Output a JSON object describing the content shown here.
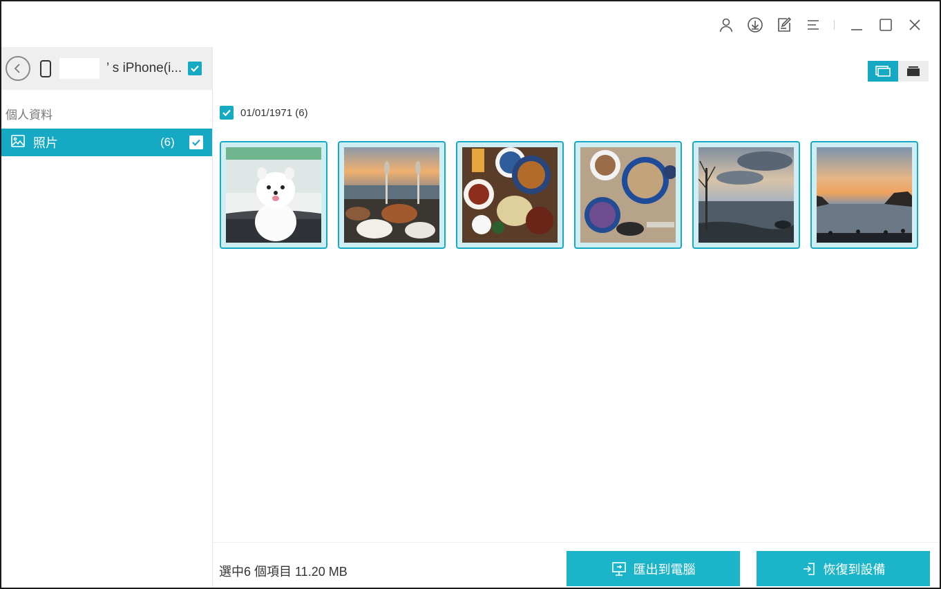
{
  "titlebar": {
    "icons": [
      "user-icon",
      "download-icon",
      "edit-icon",
      "menu-icon",
      "minimize-icon",
      "maximize-icon",
      "close-icon"
    ]
  },
  "device": {
    "name": "’ s iPhone(i..."
  },
  "sidebar": {
    "section_label": "個人資料",
    "items": [
      {
        "label": "照片",
        "count": "(6)",
        "icon": "photo-icon"
      }
    ]
  },
  "main": {
    "date_group": "01/01/1971 (6)",
    "photos": [
      "dog",
      "beach-dinner",
      "food-spread",
      "food-bowls",
      "sea-sunset",
      "coast-sunset"
    ]
  },
  "footer": {
    "selection_info": "選中6 個項目 11.20 MB",
    "export_label": "匯出到電腦",
    "restore_label": "恢復到設備"
  },
  "colors": {
    "accent": "#16a9c4",
    "button": "#1bb4c9"
  }
}
